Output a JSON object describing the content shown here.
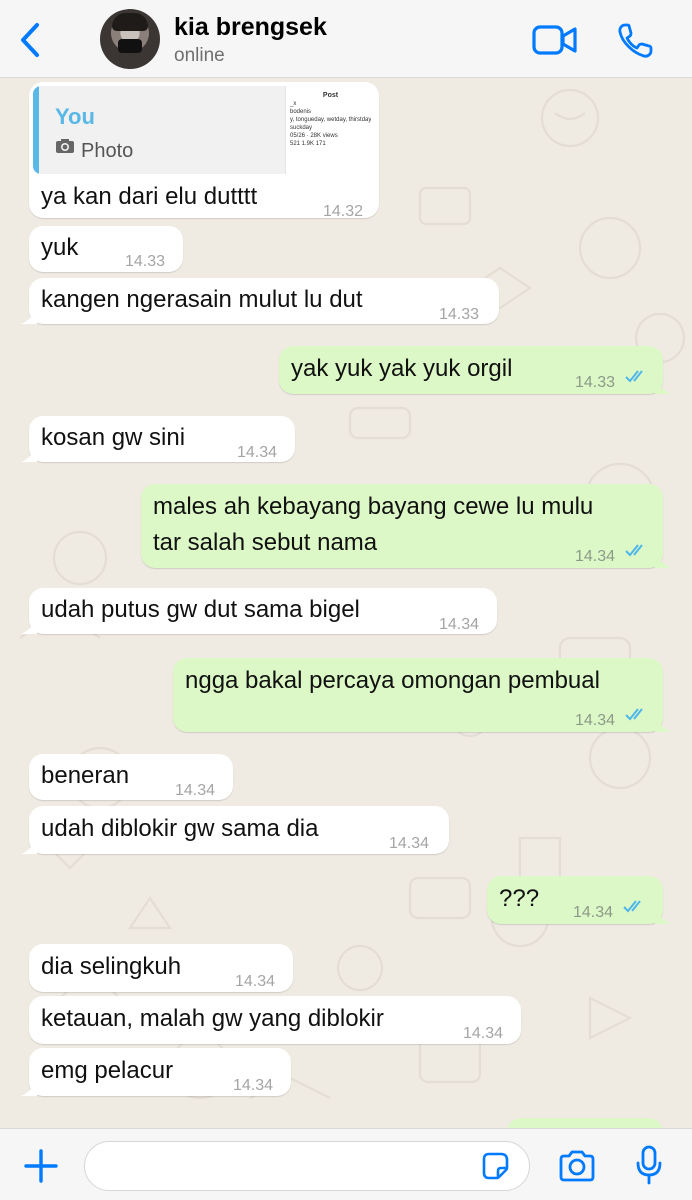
{
  "header": {
    "contact_name": "kia brengsek",
    "status": "online"
  },
  "reply_quote": {
    "author": "You",
    "type_label": "Photo",
    "thumbnail": {
      "title": "Post",
      "lines": [
        "_x",
        "bodenis",
        "y, tongueday, wetday, thirstday, fre",
        "suckday",
        "05/26 · 28K views",
        "521   1.9K   171"
      ]
    }
  },
  "messages": [
    {
      "dir": "in",
      "text": "ya kan dari elu dutttt",
      "time": "14.32"
    },
    {
      "dir": "in",
      "text": "yuk",
      "time": "14.33"
    },
    {
      "dir": "in",
      "text": "kangen ngerasain mulut lu dut",
      "time": "14.33"
    },
    {
      "dir": "out",
      "text": "yak yuk yak yuk orgil",
      "time": "14.33",
      "read": true
    },
    {
      "dir": "in",
      "text": "kosan gw sini",
      "time": "14.34"
    },
    {
      "dir": "out",
      "lines": [
        "males ah kebayang bayang cewe lu mulu",
        "tar salah sebut nama"
      ],
      "time": "14.34",
      "read": true
    },
    {
      "dir": "in",
      "text": "udah putus gw dut sama bigel",
      "time": "14.34"
    },
    {
      "dir": "out",
      "text": "ngga bakal percaya omongan pembual",
      "time": "14.34",
      "read": true
    },
    {
      "dir": "in",
      "text": "beneran",
      "time": "14.34"
    },
    {
      "dir": "in",
      "text": "udah diblokir gw sama dia",
      "time": "14.34"
    },
    {
      "dir": "out",
      "text": "???",
      "time": "14.34",
      "read": true
    },
    {
      "dir": "in",
      "text": "dia selingkuh",
      "time": "14.34"
    },
    {
      "dir": "in",
      "text": "ketauan, malah gw yang diblokir",
      "time": "14.34"
    },
    {
      "dir": "in",
      "text": "emg pelacur",
      "time": "14.34"
    }
  ],
  "composer": {
    "placeholder": ""
  },
  "colors": {
    "accent": "#007aff",
    "incoming_bubble": "#ffffff",
    "outgoing_bubble": "#dcf8c6",
    "chat_background": "#efeae2",
    "read_ticks": "#4fb6ec",
    "quote_accent": "#5ab8e6"
  },
  "icons": {
    "back": "chevron-left-icon",
    "video": "video-camera-icon",
    "call": "phone-icon",
    "attach": "plus-icon",
    "sticker": "sticker-icon",
    "camera": "camera-icon",
    "mic": "microphone-icon"
  }
}
